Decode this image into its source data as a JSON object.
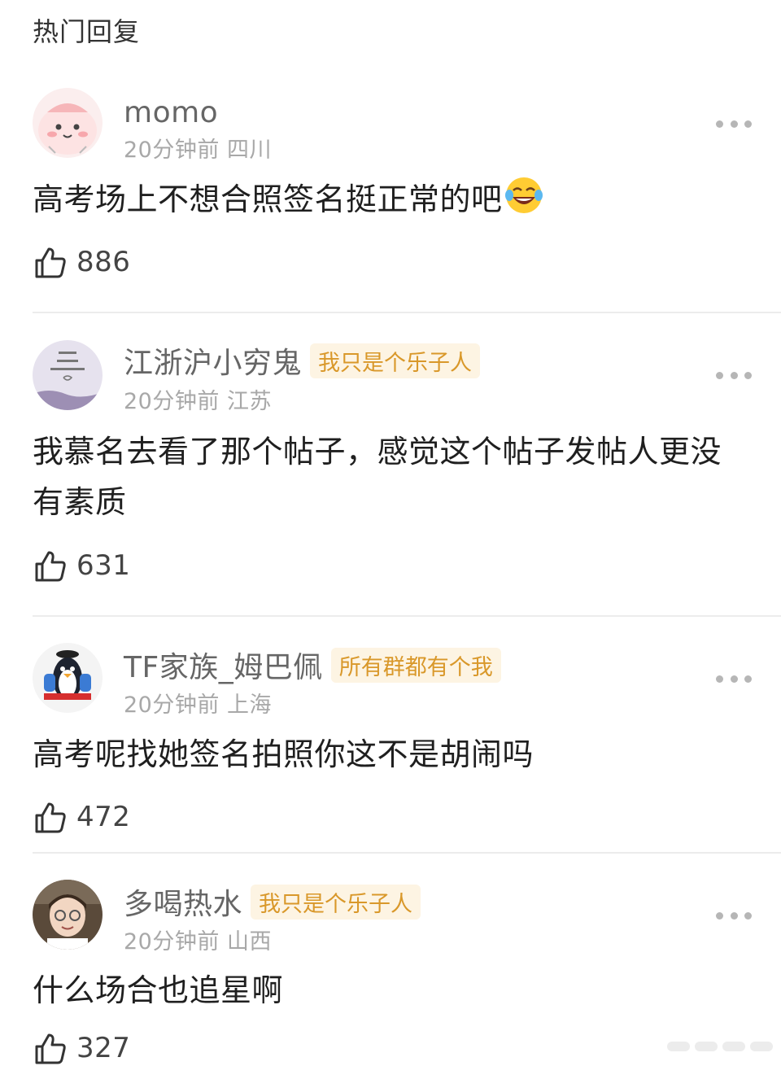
{
  "section_title": "热门回复",
  "comments": [
    {
      "username": "momo",
      "badge": "",
      "time": "20分钟前",
      "location": "四川",
      "content": "高考场上不想合照签名挺正常的吧",
      "emoji": "laughing-tears-emoji",
      "likes": "886",
      "avatar": "pink-cartoon-avatar"
    },
    {
      "username": "江浙沪小穷鬼",
      "badge": "我只是个乐子人",
      "time": "20分钟前",
      "location": "江苏",
      "content": "我慕名去看了那个帖子，感觉这个帖子发帖人更没有素质",
      "likes": "631",
      "avatar": "lavender-text-avatar"
    },
    {
      "username": "TF家族_姆巴佩",
      "badge": "所有群都有个我",
      "time": "20分钟前",
      "location": "上海",
      "content": "高考呢找她签名拍照你这不是胡闹吗",
      "likes": "472",
      "avatar": "penguin-avatar"
    },
    {
      "username": "多喝热水",
      "badge": "我只是个乐子人",
      "time": "20分钟前",
      "location": "山西",
      "content": "什么场合也追星啊",
      "likes": "327",
      "avatar": "photo-avatar"
    }
  ],
  "colors": {
    "badge_text": "#d9982a",
    "badge_bg": "#fdf4e3",
    "meta": "#a8a8a8",
    "username": "#666666"
  }
}
